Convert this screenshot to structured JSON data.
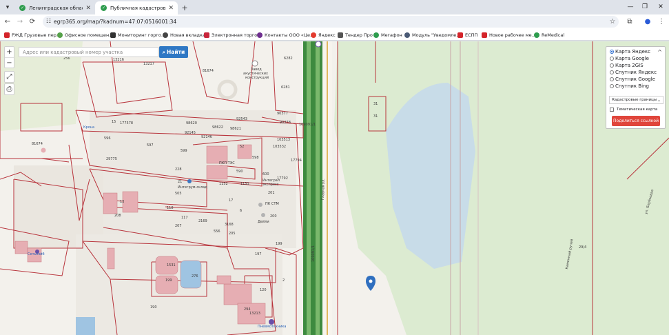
{
  "tabs": [
    {
      "title": "Ленинградская область, Всево",
      "active": false
    },
    {
      "title": "Публичная кадастровая карта",
      "active": true
    }
  ],
  "icons": {
    "down_arrow": "▾",
    "close": "✕",
    "plus": "+",
    "minimize": "—",
    "restore": "❐",
    "back": "←",
    "forward": "→",
    "reload": "⟳",
    "tune": "☷",
    "star": "☆",
    "extensions": "⧉",
    "profile": "●",
    "menu": "⋮",
    "search_glyph": "⌕",
    "chevron_up": "^",
    "chevron_down": "⌄",
    "measure": "⤢",
    "print": "⎙"
  },
  "address": {
    "url": "egrp365.org/map/?kadnum=47:07:0516001:34"
  },
  "bookmarks": [
    {
      "label": "РЖД Грузовые пер...",
      "color": "#d4242a"
    },
    {
      "label": "Офисное помещен...",
      "color": "#56a14a"
    },
    {
      "label": "Мониторинг горго...",
      "color": "#333333"
    },
    {
      "label": "Новая вкладка",
      "color": "#444444"
    },
    {
      "label": "Электронная торго...",
      "color": "#c8253b"
    },
    {
      "label": "Контакты ООО «Це...",
      "color": "#6f2f8f"
    },
    {
      "label": "Яндекс",
      "color": "#e33b2e"
    },
    {
      "label": "Тендер Про",
      "color": "#555555"
    },
    {
      "label": "Мегафон",
      "color": "#2e9c4e"
    },
    {
      "label": "Модуль \"Уведомле...",
      "color": "#4a5a75"
    },
    {
      "label": "ЕСПП",
      "color": "#d4242a"
    },
    {
      "label": "Новое рабочее ме...",
      "color": "#d4242a"
    },
    {
      "label": "ReMedical",
      "color": "#2e9c4e"
    }
  ],
  "map": {
    "zoom_in": "+",
    "zoom_out": "−",
    "search_placeholder": "Адрес или кадастровый номер участка",
    "search_button": "Найти",
    "layers": {
      "options": [
        "Карта Яндекс",
        "Карта Google",
        "Карта 2GIS",
        "Спутник Яндекс",
        "Спутник Google",
        "Спутник Bing"
      ],
      "selected": "Карта Яндекс",
      "boundaries": "Кадастровые границы",
      "thematic": "Тематическая карта",
      "share": "Поделиться ссылкой"
    },
    "labels": {
      "l256": "256",
      "l13216": "13216",
      "l13217": "13217",
      "l81674a": "81674",
      "zavod": "Завод",
      "akust": "акустических",
      "konstr": "конструкций",
      "l6282": "6282",
      "l6281": "6281",
      "l90377": "90377",
      "l90378": "90378",
      "l109091": "109091/1",
      "l31a": "31",
      "l31b": "31",
      "l15": "15",
      "l177578": "177578",
      "l98620": "98620",
      "l98622": "98622",
      "l98621": "98621",
      "l92543": "92543",
      "l92145": "92145",
      "l92146": "92146",
      "l103513": "103513",
      "l103532": "103532",
      "kron": "Крона",
      "l596": "596",
      "l597": "597",
      "l81674b": "81674",
      "l52": "52",
      "l599": "599",
      "l29775": "29775",
      "l17794": "17794",
      "l228": "228",
      "pkp": "ПКП ТЭС",
      "l590": "590",
      "l598": "598",
      "l600": "600",
      "l1152": "1152",
      "l1151": "1151",
      "l17792": "17792",
      "integral": "Интеграл",
      "ekspress": "экспресс",
      "int_sklad": "Интегрум-склад",
      "l21": "21",
      "l505": "505",
      "l201": "201",
      "l13": "13",
      "l17": "17",
      "pkstm": "ПК СТМ",
      "l118": "118",
      "l208": "208",
      "l200": "200",
      "l6": "6",
      "deyli": "Дейли",
      "l117": "117",
      "l2169": "2169",
      "l3168": "3168",
      "l207": "207",
      "l556": "556",
      "l205": "205",
      "l199": "199",
      "glavnaya": "Главная ул.",
      "l197": "197",
      "setb": "Сетьбэйб",
      "l1531": "1531",
      "l276": "276",
      "l199b": "199",
      "l190": "190",
      "l120": "120",
      "l2": "2",
      "l13213": "13213",
      "pnevm": "Пневмотехника",
      "l294": "294",
      "kamenny": "Каменный ручей",
      "ul_berezovaya": "ул. Берёзовая",
      "l29_4": "29/4",
      "l109091b": "109091/1"
    }
  }
}
